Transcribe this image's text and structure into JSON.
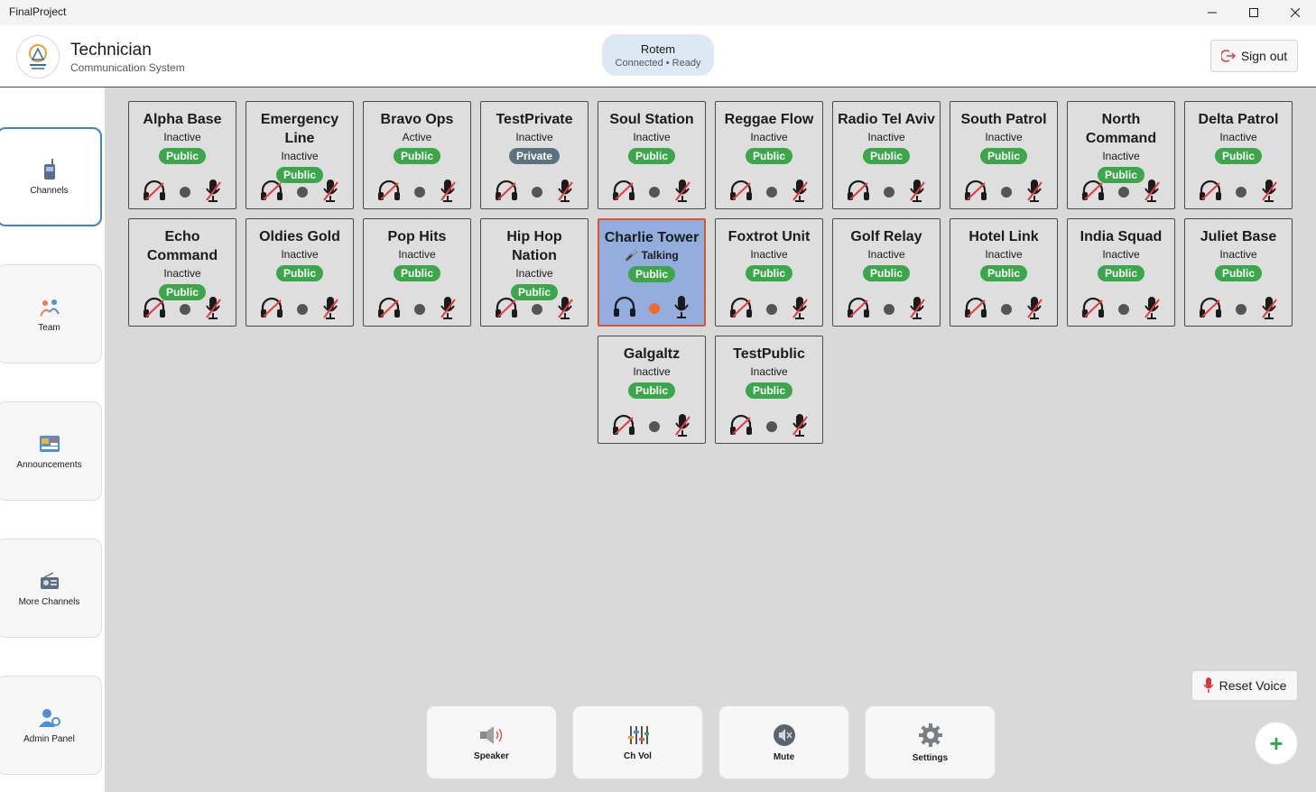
{
  "window": {
    "title": "FinalProject"
  },
  "header": {
    "title": "Technician",
    "subtitle": "Communication System",
    "user_name": "Rotem",
    "user_status": "Connected • Ready",
    "signout_label": "Sign out"
  },
  "sidebar": {
    "items": [
      {
        "label": "Channels",
        "icon": "radio-icon",
        "active": true
      },
      {
        "label": "Team",
        "icon": "team-icon",
        "active": false
      },
      {
        "label": "Announcements",
        "icon": "announcement-icon",
        "active": false
      },
      {
        "label": "More Channels",
        "icon": "more-channels-icon",
        "active": false
      },
      {
        "label": "Admin Panel",
        "icon": "admin-icon",
        "active": false
      }
    ]
  },
  "channels": [
    {
      "name": "Alpha Base",
      "status": "Inactive",
      "badge": "Public",
      "talking": false
    },
    {
      "name": "Emergency Line",
      "status": "Inactive",
      "badge": "Public",
      "talking": false
    },
    {
      "name": "Bravo Ops",
      "status": "Active",
      "badge": "Public",
      "talking": false
    },
    {
      "name": "TestPrivate",
      "status": "Inactive",
      "badge": "Private",
      "talking": false
    },
    {
      "name": "Soul Station",
      "status": "Inactive",
      "badge": "Public",
      "talking": false
    },
    {
      "name": "Reggae Flow",
      "status": "Inactive",
      "badge": "Public",
      "talking": false
    },
    {
      "name": "Radio Tel Aviv",
      "status": "Inactive",
      "badge": "Public",
      "talking": false
    },
    {
      "name": "South Patrol",
      "status": "Inactive",
      "badge": "Public",
      "talking": false
    },
    {
      "name": "North Command",
      "status": "Inactive",
      "badge": "Public",
      "talking": false
    },
    {
      "name": "Delta Patrol",
      "status": "Inactive",
      "badge": "Public",
      "talking": false
    },
    {
      "name": "Echo Command",
      "status": "Inactive",
      "badge": "Public",
      "talking": false
    },
    {
      "name": "Oldies Gold",
      "status": "Inactive",
      "badge": "Public",
      "talking": false
    },
    {
      "name": "Pop Hits",
      "status": "Inactive",
      "badge": "Public",
      "talking": false
    },
    {
      "name": "Hip Hop Nation",
      "status": "Inactive",
      "badge": "Public",
      "talking": false
    },
    {
      "name": "Charlie Tower",
      "status": "🎤 Talking",
      "badge": "Public",
      "talking": true
    },
    {
      "name": "Foxtrot Unit",
      "status": "Inactive",
      "badge": "Public",
      "talking": false
    },
    {
      "name": "Golf Relay",
      "status": "Inactive",
      "badge": "Public",
      "talking": false
    },
    {
      "name": "Hotel Link",
      "status": "Inactive",
      "badge": "Public",
      "talking": false
    },
    {
      "name": "India Squad",
      "status": "Inactive",
      "badge": "Public",
      "talking": false
    },
    {
      "name": "Juliet Base",
      "status": "Inactive",
      "badge": "Public",
      "talking": false
    },
    {
      "name": "Galgaltz",
      "status": "Inactive",
      "badge": "Public",
      "talking": false
    },
    {
      "name": "TestPublic",
      "status": "Inactive",
      "badge": "Public",
      "talking": false
    }
  ],
  "toolbar": {
    "speaker_label": "Speaker",
    "chvol_label": "Ch Vol",
    "mute_label": "Mute",
    "settings_label": "Settings",
    "reset_voice_label": "Reset Voice",
    "add_label": "+"
  },
  "colors": {
    "public": "#3ca64a",
    "private": "#5d7280",
    "talking_bg": "#93aede",
    "talking_border": "#d85a2c",
    "accent": "#3b82e6"
  }
}
